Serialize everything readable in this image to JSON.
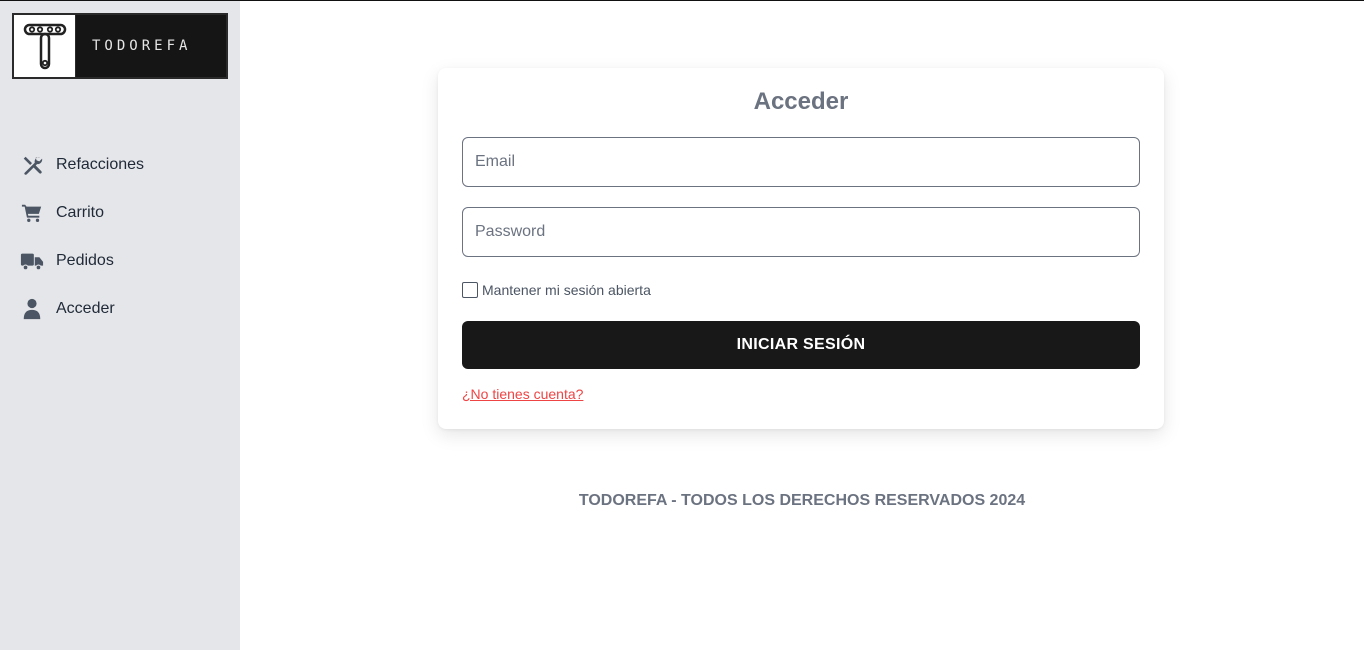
{
  "brand": {
    "name": "TODOREFA"
  },
  "sidebar": {
    "items": [
      {
        "label": "Refacciones",
        "icon": "tools-icon"
      },
      {
        "label": "Carrito",
        "icon": "cart-icon"
      },
      {
        "label": "Pedidos",
        "icon": "truck-icon"
      },
      {
        "label": "Acceder",
        "icon": "user-icon"
      }
    ]
  },
  "login": {
    "title": "Acceder",
    "email_placeholder": "Email",
    "password_placeholder": "Password",
    "remember_label": "Mantener mi sesión abierta",
    "submit_label": "INICIAR SESIÓN",
    "signup_link": "¿No tienes cuenta?"
  },
  "footer": {
    "text": "TODOREFA - TODOS LOS DERECHOS RESERVADOS 2024"
  },
  "colors": {
    "sidebar_bg": "#e5e6ea",
    "button_bg": "#181818",
    "link": "#ef4444",
    "muted_text": "#6b7280"
  }
}
